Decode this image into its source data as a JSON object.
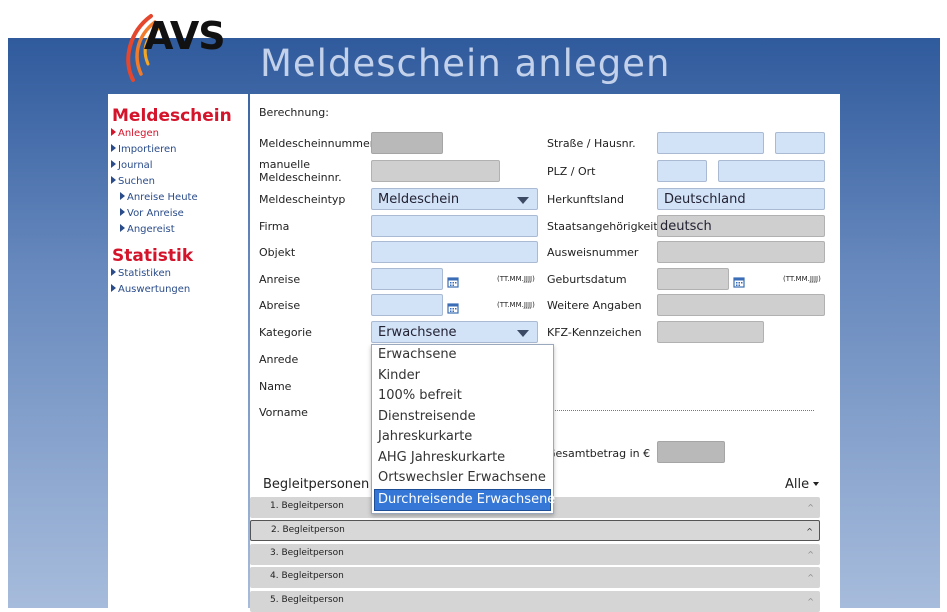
{
  "brand": {
    "logo_text": "AVS"
  },
  "page_title": "Meldeschein anlegen",
  "sidebar": {
    "section1": "Meldeschein",
    "items": [
      {
        "label": "Anlegen"
      },
      {
        "label": "Importieren"
      },
      {
        "label": "Journal"
      },
      {
        "label": "Suchen"
      },
      {
        "label": "Anreise Heute"
      },
      {
        "label": "Vor Anreise"
      },
      {
        "label": "Angereist"
      }
    ],
    "section2": "Statistik",
    "items2": [
      {
        "label": "Statistiken"
      },
      {
        "label": "Auswertungen"
      }
    ]
  },
  "form": {
    "berechnung": "Berechnung:",
    "meldescheinnummer": "Meldescheinnummer",
    "manuelle": "manuelle Meldescheinnr.",
    "meldescheintyp": "Meldescheintyp",
    "meldescheintyp_value": "Meldeschein",
    "firma": "Firma",
    "objekt": "Objekt",
    "anreise": "Anreise",
    "abreise": "Abreise",
    "date_format": "(TT.MM.JJJJ)",
    "kategorie": "Kategorie",
    "kategorie_value": "Erwachsene",
    "anrede": "Anrede",
    "name": "Name",
    "vorname": "Vorname",
    "strasse": "Straße / Hausnr.",
    "plz": "PLZ / Ort",
    "herkunftsland": "Herkunftsland",
    "herkunftsland_value": "Deutschland",
    "staatsangehoerigkeit": "Staatsangehörigkeit",
    "staatsangehoerigkeit_value": "deutsch",
    "ausweisnummer": "Ausweisnummer",
    "geburtsdatum": "Geburtsdatum",
    "weitere": "Weitere Angaben",
    "kfz": "KFZ-Kennzeichen",
    "gesamtbetrag": "Gesamtbetrag in €"
  },
  "kategorie_options": [
    "Erwachsene",
    "Kinder",
    "100% befreit",
    "Dienstreisende",
    "Jahreskurkarte",
    "AHG Jahreskurkarte",
    "Ortswechsler Erwachsene",
    "Durchreisende Erwachsene"
  ],
  "begleitpersonen": {
    "title": "Begleitpersonen",
    "alle": "Alle",
    "rows": [
      "1. Begleitperson",
      "2. Begleitperson",
      "3. Begleitperson",
      "4. Begleitperson",
      "5. Begleitperson"
    ]
  },
  "colors": {
    "accent": "#d4142b",
    "link": "#2a4c8a",
    "input_bg": "#d3e3f7",
    "selected": "#3477d6"
  }
}
